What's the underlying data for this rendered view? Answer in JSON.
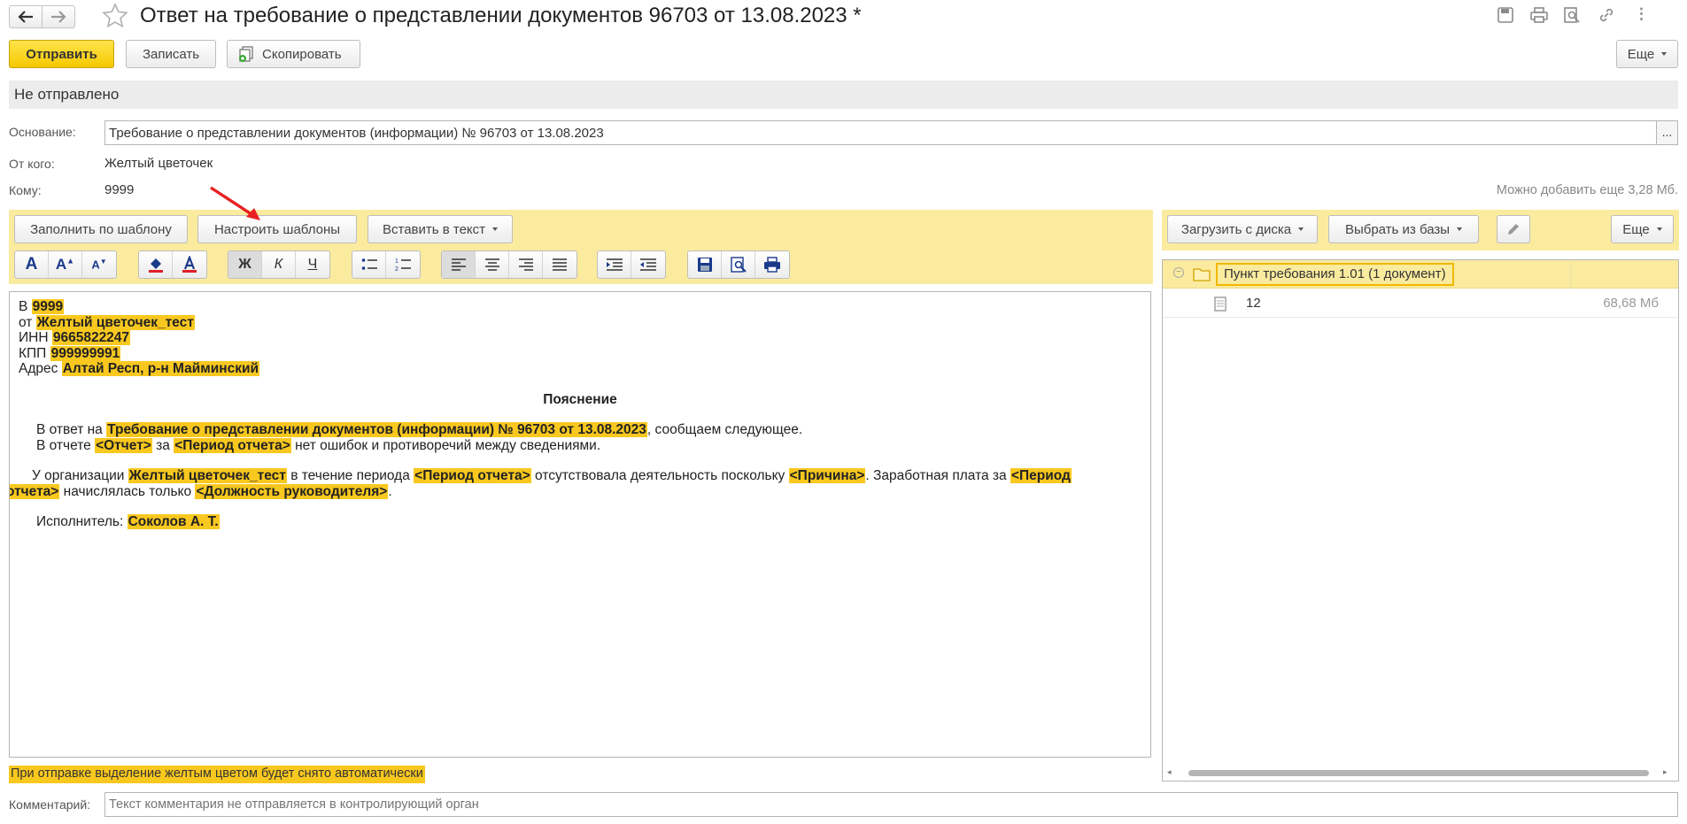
{
  "header": {
    "title": "Ответ на требование о представлении документов 96703 от 13.08.2023 *",
    "back_icon": "arrow-left-icon",
    "forward_icon": "arrow-right-icon",
    "favorite_icon": "star-icon"
  },
  "toolbar": {
    "send_label": "Отправить",
    "save_label": "Записать",
    "copy_label": "Скопировать",
    "more_label": "Еще"
  },
  "status": {
    "text": "Не отправлено"
  },
  "fields": {
    "basis_label": "Основание:",
    "basis_value": "Требование о представлении документов (информации) № 96703 от 13.08.2023",
    "basis_select_label": "...",
    "from_label": "От кого:",
    "from_value": "Желтый цветочек",
    "to_label": "Кому:",
    "to_value": "9999",
    "size_note": "Можно добавить еще 3,28 Мб."
  },
  "template_toolbar": {
    "fill_label": "Заполнить по шаблону",
    "configure_label": "Настроить шаблоны",
    "insert_label": "Вставить в текст"
  },
  "format_toolbar": {
    "bold": "Ж",
    "italic": "К",
    "underline": "Ч",
    "font_a": "A"
  },
  "letter": {
    "to_prefix": "В",
    "to_value": "9999",
    "from_prefix": "от",
    "from_value": "Желтый цветочек_тест",
    "inn_prefix": "ИНН",
    "inn_value": "9665822247",
    "kpp_prefix": "КПП",
    "kpp_value": "999999991",
    "address_prefix": "Адрес",
    "address_value": "Алтай Респ, р-н Майминский",
    "heading": "Пояснение",
    "p1_prefix": "В ответ на",
    "p1_highlight": "Требование о представлении документов (информации) № 96703 от 13.08.2023",
    "p1_suffix": ", сообщаем следующее.",
    "p2_prefix": "В отчете",
    "p2_report": "<Отчет>",
    "p2_for": "за",
    "p2_period": "<Период отчета>",
    "p2_suffix": "нет ошибок и противоречий между сведениями.",
    "p3_prefix": "У организации",
    "p3_org": "Желтый цветочек_тест",
    "p3_mid1": "в течение периода",
    "p3_period": "<Период отчета>",
    "p3_mid2": "отсутствовала деятельность поскольку",
    "p3_reason": "<Причина>",
    "p3_mid3": ". Заработная плата за",
    "p3_period2a": "<Период",
    "p3_period2b": "отчета>",
    "p3_mid4": "начислялась только",
    "p3_position": "<Должность руководителя>",
    "p3_end": ".",
    "executor_prefix": "Исполнитель:",
    "executor_value": "Соколов А. Т."
  },
  "notice": "При отправке выделение желтым цветом будет снято автоматически",
  "comment": {
    "label": "Комментарий:",
    "placeholder": "Текст комментария не отправляется в контролирующий орган"
  },
  "files_toolbar": {
    "upload_label": "Загрузить с диска",
    "select_label": "Выбрать из базы",
    "more_label": "Еще"
  },
  "files": {
    "group_label": "Пункт требования 1.01 (1 документ)",
    "items": [
      {
        "name": "12",
        "size": "68,68 Мб"
      }
    ]
  },
  "colors": {
    "accent": "#f5c800",
    "highlight": "#f9c81f",
    "panel": "#fbeb9e"
  }
}
